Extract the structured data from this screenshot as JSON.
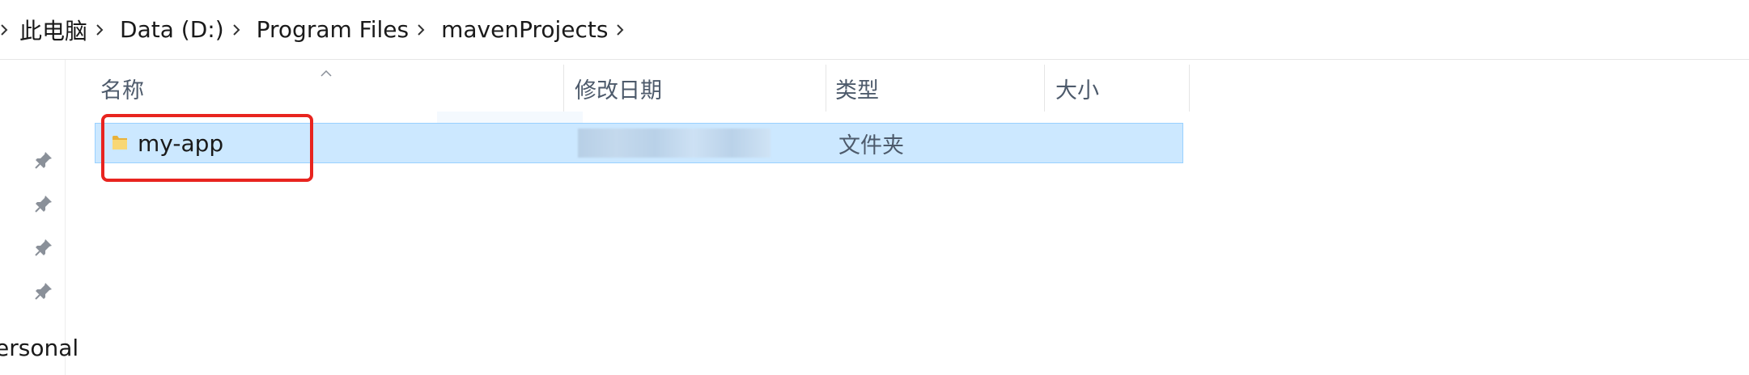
{
  "breadcrumb": {
    "items": [
      "此电脑",
      "Data (D:)",
      "Program Files",
      "mavenProjects"
    ]
  },
  "navpane": {
    "partial_label": "ersonal"
  },
  "columns": {
    "name": "名称",
    "date_modified": "修改日期",
    "type": "类型",
    "size": "大小"
  },
  "rows": [
    {
      "name": "my-app",
      "type": "文件夹",
      "size": ""
    }
  ],
  "icons": {
    "breadcrumb_separator": "chevron-right-icon",
    "pin": "pin-icon",
    "folder": "folder-icon",
    "sort": "sort-ascending-icon"
  },
  "colors": {
    "selection_bg": "#cce8ff",
    "selection_border": "#99d1ff",
    "annotation": "#e8241f"
  }
}
